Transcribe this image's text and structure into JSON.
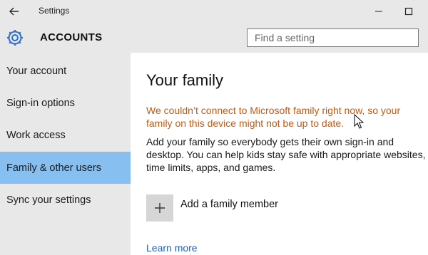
{
  "window": {
    "title": "Settings"
  },
  "header": {
    "section_title": "ACCOUNTS",
    "icon": "gear-icon"
  },
  "search": {
    "placeholder": "Find a setting"
  },
  "sidebar": {
    "items": [
      {
        "label": "Your account",
        "selected": false
      },
      {
        "label": "Sign-in options",
        "selected": false
      },
      {
        "label": "Work access",
        "selected": false
      },
      {
        "label": "Family & other users",
        "selected": true
      },
      {
        "label": "Sync your settings",
        "selected": false
      }
    ]
  },
  "main": {
    "title": "Your family",
    "warning": "We couldn’t connect to Microsoft family right now, so your family on this device might not be up to date.",
    "description": "Add your family so everybody gets their own sign-in and desktop. You can help kids stay safe with appropriate websites, time limits, apps, and games.",
    "add_member_label": "Add a family member",
    "learn_more": "Learn more"
  },
  "colors": {
    "accent": "#86bff0",
    "warning": "#c8590f",
    "link": "#2062b8",
    "chrome": "#e8e8e8"
  }
}
